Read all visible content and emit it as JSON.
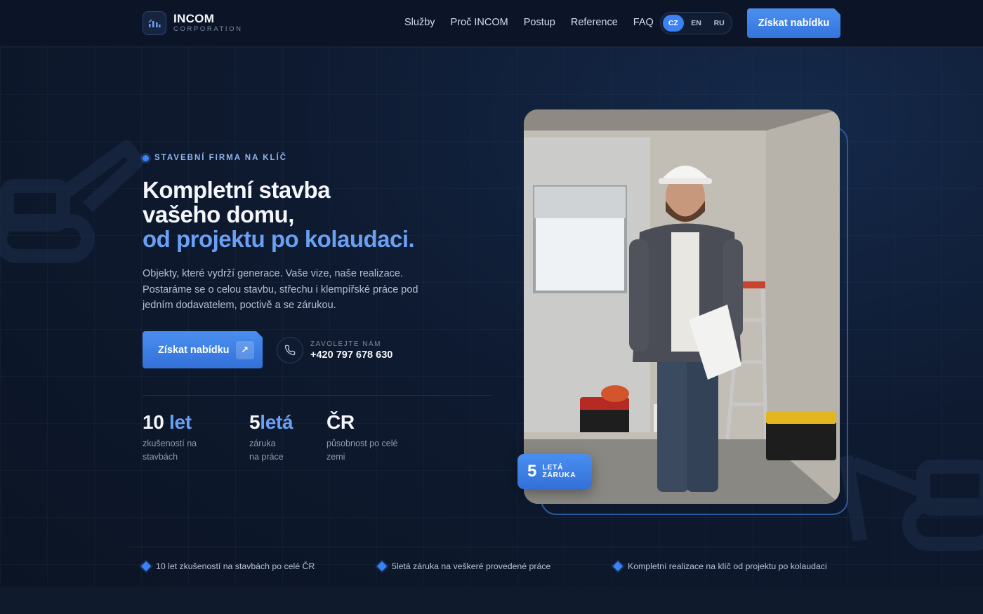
{
  "brand": {
    "name": "INCOM",
    "subtitle": "CORPORATION"
  },
  "nav": {
    "items": [
      {
        "label": "Služby"
      },
      {
        "label": "Proč INCOM"
      },
      {
        "label": "Postup"
      },
      {
        "label": "Reference"
      },
      {
        "label": "FAQ"
      }
    ],
    "languages": [
      {
        "label": "CZ",
        "active": true
      },
      {
        "label": "EN",
        "active": false
      },
      {
        "label": "RU",
        "active": false
      }
    ],
    "cta_label": "Získat nabídku"
  },
  "hero": {
    "eyebrow": "STAVEBNÍ FIRMA NA KLÍČ",
    "title_line1": "Kompletní stavba",
    "title_line2": "vašeho domu,",
    "title_line3": "od projektu po kolaudaci.",
    "lead": "Objekty, které vydrží generace. Vaše vize, naše realizace. Postaráme se o celou stavbu, střechu i klempířské práce pod jedním dodavatelem, poctivě a se zárukou.",
    "cta_label": "Získat nabídku",
    "phone_label": "ZAVOLEJTE NÁM",
    "phone_number": "+420 797 678 630"
  },
  "stats": [
    {
      "value": "10",
      "highlight": " let",
      "line1": "zkušeností na",
      "line2": "stavbách"
    },
    {
      "value": "5",
      "highlight": "letá",
      "line1": "záruka",
      "line2": "na práce"
    },
    {
      "value": "ČR",
      "highlight": "",
      "line1": "působnost po celé",
      "line2": "zemi"
    }
  ],
  "badge": {
    "number": "5",
    "line1": "LETÁ",
    "line2": "ZÁRUKA"
  },
  "features": [
    {
      "text": "10 let zkušeností na stavbách po celé ČR"
    },
    {
      "text": "5letá záruka na veškeré provedené práce"
    },
    {
      "text": "Kompletní realizace na klíč od projektu po kolaudaci"
    }
  ],
  "colors": {
    "accent": "#3b82f6",
    "accent_light": "#6aa0f3",
    "background": "#0d1526"
  }
}
